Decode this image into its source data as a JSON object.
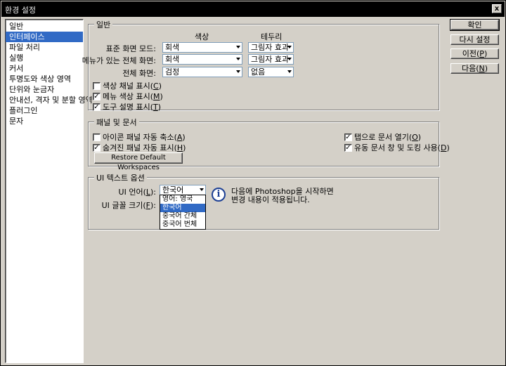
{
  "window": {
    "title": "환경 설정",
    "close_label": "x"
  },
  "nav": {
    "items": [
      {
        "label": "일반",
        "selected": false
      },
      {
        "label": "인터페이스",
        "selected": true
      },
      {
        "label": "파일 처리",
        "selected": false
      },
      {
        "label": "실행",
        "selected": false
      },
      {
        "label": "커서",
        "selected": false
      },
      {
        "label": "투명도와 색상 영역",
        "selected": false
      },
      {
        "label": "단위와 눈금자",
        "selected": false
      },
      {
        "label": "안내선, 격자 및 분할 영역",
        "selected": false
      },
      {
        "label": "플러그인",
        "selected": false
      },
      {
        "label": "문자",
        "selected": false
      }
    ]
  },
  "general": {
    "title": "일반",
    "col_color": "색상",
    "col_border": "테두리",
    "rows": [
      {
        "label": "표준 화면 모드:",
        "color": "회색",
        "border": "그림자 효과"
      },
      {
        "label": "메뉴가 있는 전체 화면:",
        "color": "회색",
        "border": "그림자 효과"
      },
      {
        "label": "전체 화면:",
        "color": "검정",
        "border": "없음"
      }
    ],
    "checks": [
      {
        "label": "색상 채널 표시(",
        "key": "C",
        "suffix": ")",
        "checked": false
      },
      {
        "label": "메뉴 색상 표시(",
        "key": "M",
        "suffix": ")",
        "checked": true
      },
      {
        "label": "도구 설명 표시(",
        "key": "T",
        "suffix": ")",
        "checked": true
      }
    ]
  },
  "panels": {
    "title": "패널 및 문서",
    "left_checks": [
      {
        "label": "아이콘 패널 자동 축소(",
        "key": "A",
        "suffix": ")",
        "checked": false
      },
      {
        "label": "숨겨진 패널 자동 표시(",
        "key": "H",
        "suffix": ")",
        "checked": true
      }
    ],
    "right_checks": [
      {
        "label": "탭으로 문서 열기(",
        "key": "O",
        "suffix": ")",
        "checked": true
      },
      {
        "label": "유동 문서 창 및 도킹 사용(",
        "key": "D",
        "suffix": ")",
        "checked": true
      }
    ],
    "restore_button": "Restore Default Workspaces"
  },
  "ui_text": {
    "title": "UI 텍스트 옵션",
    "language_label": "UI 언어(",
    "language_key": "L",
    "language_suffix": "):",
    "language_value": "한국어",
    "font_size_label": "UI 글꼴 크기(",
    "font_size_key": "F",
    "font_size_suffix": "):",
    "dropdown_options": [
      {
        "label": "영어: 영국",
        "selected": false
      },
      {
        "label": "한국어",
        "selected": true
      },
      {
        "label": "중국어 간체",
        "selected": false
      },
      {
        "label": "중국어 번체",
        "selected": false
      }
    ],
    "info_line1": "다음에 Photoshop을 시작하면",
    "info_line2": "변경 내용이 적용됩니다."
  },
  "buttons": {
    "ok": "확인",
    "reset": "다시 설정",
    "prev": "이전(",
    "prev_key": "P",
    "next": "다음(",
    "next_key": "N",
    "close_paren": ")"
  },
  "colors": {
    "selection": "#316ac5",
    "face": "#d4d0c8",
    "titlebar": "#000000"
  },
  "icons": {
    "close": "close-icon",
    "info": "info-icon",
    "dropdown": "chevron-down-icon",
    "check": "checkmark-icon"
  }
}
